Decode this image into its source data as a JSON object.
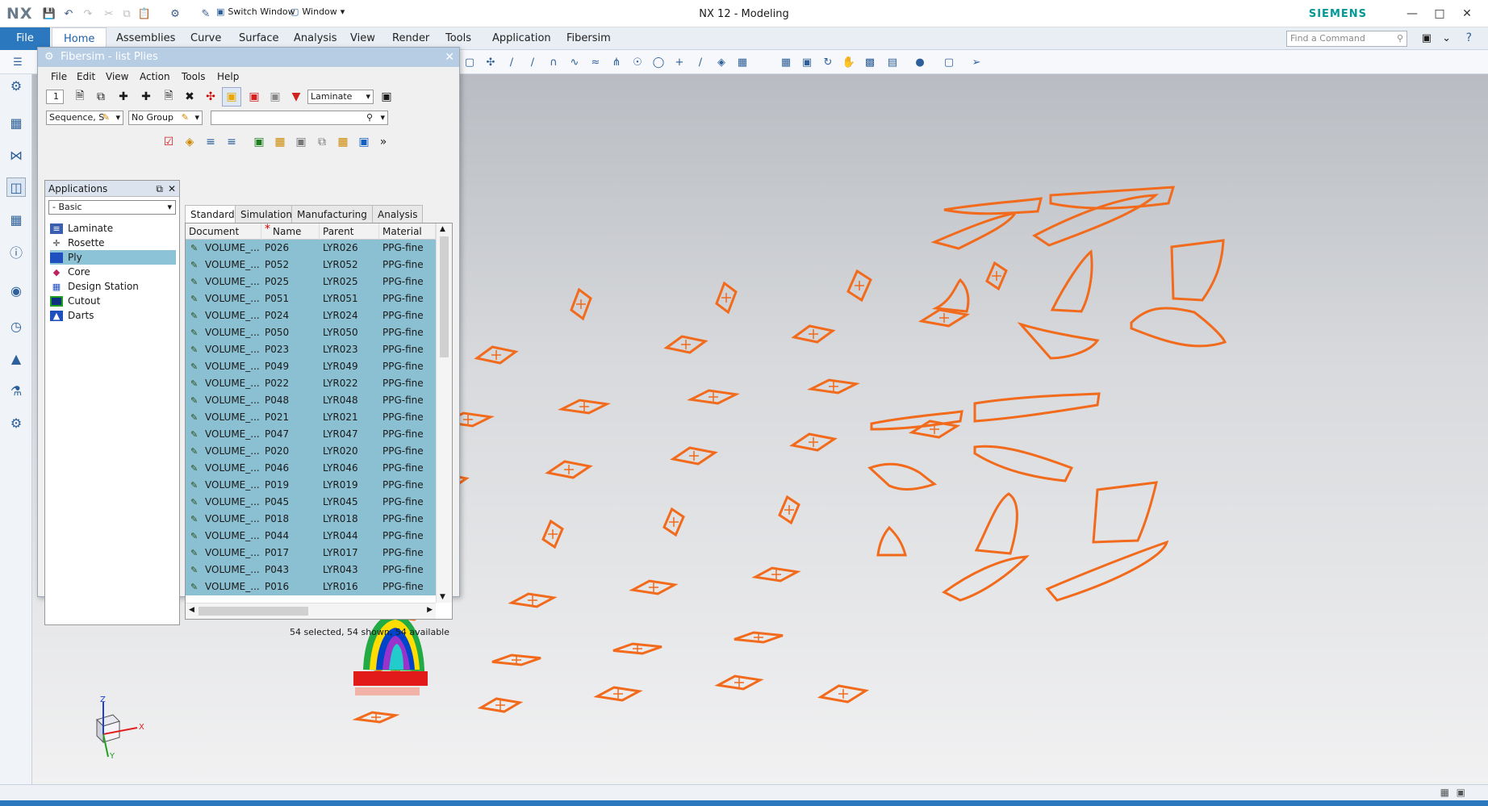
{
  "window": {
    "logo": "NX",
    "title": "NX 12 - Modeling",
    "brand": "SIEMENS",
    "switch_window": "Switch Window",
    "window_menu": "Window"
  },
  "menu": {
    "file": "File",
    "tabs": [
      "Home",
      "Assemblies",
      "Curve",
      "Surface",
      "Analysis",
      "View",
      "Render",
      "Tools",
      "Application",
      "Fibersim"
    ],
    "find_placeholder": "Find a Command"
  },
  "panel": {
    "title": "Fibersim - list Plies",
    "menu": [
      "File",
      "Edit",
      "View",
      "Action",
      "Tools",
      "Help"
    ],
    "page_number": "1",
    "laminate_combo": "Laminate",
    "sequence_combo": "Sequence, S",
    "group_combo": "No Group",
    "applications": {
      "header": "Applications",
      "selector": "- Basic",
      "items": [
        "Laminate",
        "Rosette",
        "Ply",
        "Core",
        "Design Station",
        "Cutout",
        "Darts"
      ],
      "selected": "Ply"
    },
    "tabs": [
      "Standard",
      "Simulation",
      "Manufacturing",
      "Analysis"
    ],
    "columns": [
      "Document",
      "Name",
      "Parent",
      "Material"
    ],
    "required_marker": "*",
    "rows": [
      {
        "document": "VOLUME_...",
        "name": "P026",
        "parent": "LYR026",
        "material": "PPG-fine"
      },
      {
        "document": "VOLUME_...",
        "name": "P052",
        "parent": "LYR052",
        "material": "PPG-fine"
      },
      {
        "document": "VOLUME_...",
        "name": "P025",
        "parent": "LYR025",
        "material": "PPG-fine"
      },
      {
        "document": "VOLUME_...",
        "name": "P051",
        "parent": "LYR051",
        "material": "PPG-fine"
      },
      {
        "document": "VOLUME_...",
        "name": "P024",
        "parent": "LYR024",
        "material": "PPG-fine"
      },
      {
        "document": "VOLUME_...",
        "name": "P050",
        "parent": "LYR050",
        "material": "PPG-fine"
      },
      {
        "document": "VOLUME_...",
        "name": "P023",
        "parent": "LYR023",
        "material": "PPG-fine"
      },
      {
        "document": "VOLUME_...",
        "name": "P049",
        "parent": "LYR049",
        "material": "PPG-fine"
      },
      {
        "document": "VOLUME_...",
        "name": "P022",
        "parent": "LYR022",
        "material": "PPG-fine"
      },
      {
        "document": "VOLUME_...",
        "name": "P048",
        "parent": "LYR048",
        "material": "PPG-fine"
      },
      {
        "document": "VOLUME_...",
        "name": "P021",
        "parent": "LYR021",
        "material": "PPG-fine"
      },
      {
        "document": "VOLUME_...",
        "name": "P047",
        "parent": "LYR047",
        "material": "PPG-fine"
      },
      {
        "document": "VOLUME_...",
        "name": "P020",
        "parent": "LYR020",
        "material": "PPG-fine"
      },
      {
        "document": "VOLUME_...",
        "name": "P046",
        "parent": "LYR046",
        "material": "PPG-fine"
      },
      {
        "document": "VOLUME_...",
        "name": "P019",
        "parent": "LYR019",
        "material": "PPG-fine"
      },
      {
        "document": "VOLUME_...",
        "name": "P045",
        "parent": "LYR045",
        "material": "PPG-fine"
      },
      {
        "document": "VOLUME_...",
        "name": "P018",
        "parent": "LYR018",
        "material": "PPG-fine"
      },
      {
        "document": "VOLUME_...",
        "name": "P044",
        "parent": "LYR044",
        "material": "PPG-fine"
      },
      {
        "document": "VOLUME_...",
        "name": "P017",
        "parent": "LYR017",
        "material": "PPG-fine"
      },
      {
        "document": "VOLUME_...",
        "name": "P043",
        "parent": "LYR043",
        "material": "PPG-fine"
      },
      {
        "document": "VOLUME_...",
        "name": "P016",
        "parent": "LYR016",
        "material": "PPG-fine"
      }
    ],
    "status": "54 selected, 54 shown, 54 available"
  },
  "triad": {
    "x": "X",
    "y": "Y",
    "z": "Z"
  },
  "colors": {
    "accent": "#2b78be",
    "ply_outline": "#f26a1b",
    "selection": "#8bc0d2"
  }
}
